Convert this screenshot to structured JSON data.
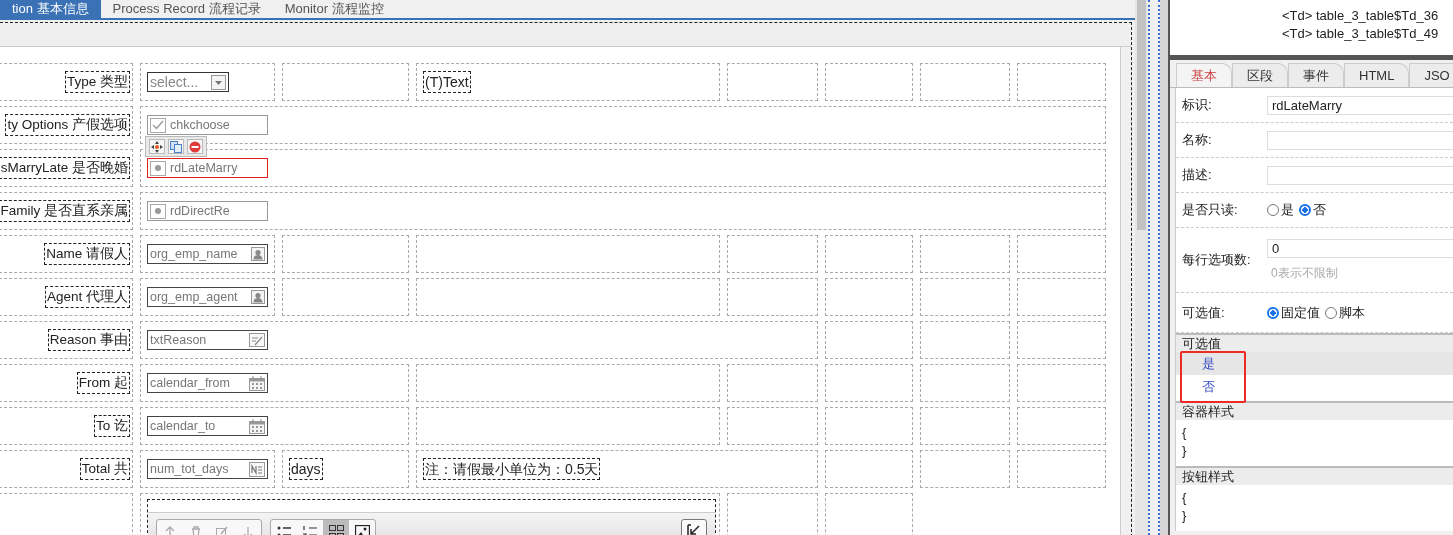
{
  "tabs": [
    {
      "label": "tion 基本信息",
      "selected": true
    },
    {
      "label": "Process Record 流程记录",
      "selected": false
    },
    {
      "label": "Monitor 流程监控",
      "selected": false
    }
  ],
  "form_rows": [
    {
      "label": "Type 类型",
      "cells": [
        {
          "kind": "select",
          "placeholder": "select...",
          "selected": false
        },
        {
          "kind": "empty"
        },
        {
          "kind": "text",
          "text": "(T)Text"
        },
        {
          "kind": "empty"
        },
        {
          "kind": "empty"
        },
        {
          "kind": "empty"
        },
        {
          "kind": "empty"
        }
      ]
    },
    {
      "label": "ty Options 产假选项",
      "cells": [
        {
          "kind": "checkbox",
          "field": "chkchoose",
          "colspan": 7,
          "selected": false,
          "toolbar": true
        }
      ]
    },
    {
      "label": "sMarryLate 是否晚婚",
      "cells": [
        {
          "kind": "radio",
          "field": "rdLateMarry",
          "colspan": 7,
          "selected": true
        }
      ]
    },
    {
      "label": "Family 是否直系亲属",
      "cells": [
        {
          "kind": "radio",
          "field": "rdDirectRe",
          "colspan": 7,
          "selected": false
        }
      ]
    },
    {
      "label": "Name 请假人",
      "cells": [
        {
          "kind": "person",
          "field": "org_emp_name",
          "selected": false
        },
        {
          "kind": "empty"
        },
        {
          "kind": "empty"
        },
        {
          "kind": "empty"
        },
        {
          "kind": "empty"
        },
        {
          "kind": "empty"
        },
        {
          "kind": "empty"
        }
      ]
    },
    {
      "label": "Agent 代理人",
      "cells": [
        {
          "kind": "person",
          "field": "org_emp_agent",
          "selected": false
        },
        {
          "kind": "empty"
        },
        {
          "kind": "empty"
        },
        {
          "kind": "empty"
        },
        {
          "kind": "empty"
        },
        {
          "kind": "empty"
        },
        {
          "kind": "empty"
        }
      ]
    },
    {
      "label": "Reason 事由",
      "cells": [
        {
          "kind": "textarea",
          "field": "txtReason",
          "colspan": 4,
          "selected": false
        },
        {
          "kind": "empty"
        },
        {
          "kind": "empty"
        },
        {
          "kind": "empty"
        }
      ]
    },
    {
      "label": "From 起",
      "cells": [
        {
          "kind": "date",
          "field": "calendar_from",
          "colspan": 2,
          "selected": false
        },
        {
          "kind": "empty"
        },
        {
          "kind": "empty"
        },
        {
          "kind": "empty"
        },
        {
          "kind": "empty"
        },
        {
          "kind": "empty"
        }
      ]
    },
    {
      "label": "To 讫",
      "cells": [
        {
          "kind": "date",
          "field": "calendar_to",
          "colspan": 2,
          "selected": false
        },
        {
          "kind": "empty"
        },
        {
          "kind": "empty"
        },
        {
          "kind": "empty"
        },
        {
          "kind": "empty"
        },
        {
          "kind": "empty"
        }
      ]
    },
    {
      "label": "Total 共",
      "cells": [
        {
          "kind": "number",
          "field": "num_tot_days",
          "selected": false
        },
        {
          "kind": "text",
          "text": "days"
        },
        {
          "kind": "text",
          "text": "注：请假最小单位为：0.5天",
          "colspan": 2
        },
        {
          "kind": "empty"
        },
        {
          "kind": "empty"
        },
        {
          "kind": "empty"
        }
      ]
    },
    {
      "cells": [
        {
          "kind": "editor",
          "colspan": 3,
          "view_buttons": [
            {
              "selected": false
            },
            {
              "selected": false
            },
            {
              "selected": true
            },
            {
              "selected": false
            }
          ]
        },
        {
          "kind": "empty"
        },
        {
          "kind": "empty"
        }
      ]
    }
  ],
  "outline": {
    "lines": [
      "<Td> table_3_table$Td_36",
      "<Td> table_3_table$Td_49"
    ]
  },
  "property_tabs": [
    {
      "label": "基本",
      "selected": true
    },
    {
      "label": "区段",
      "selected": false
    },
    {
      "label": "事件",
      "selected": false
    },
    {
      "label": "HTML",
      "selected": false
    },
    {
      "label": "JSO",
      "selected": false
    }
  ],
  "properties": [
    {
      "kind": "input",
      "label": "标识:",
      "value": "rdLateMarry"
    },
    {
      "kind": "input",
      "label": "名称:"
    },
    {
      "kind": "input",
      "label": "描述:"
    },
    {
      "kind": "radios",
      "label": "是否只读:",
      "options": [
        {
          "label": "是",
          "selected": false
        },
        {
          "label": "否",
          "selected": true
        }
      ]
    },
    {
      "kind": "input",
      "label": "每行选项数:",
      "value": "0",
      "hint": "0表示不限制"
    },
    {
      "kind": "radios",
      "label": "可选值:",
      "options": [
        {
          "label": "固定值",
          "selected": true
        },
        {
          "label": "脚本",
          "selected": false
        }
      ]
    }
  ],
  "sections": [
    {
      "kind": "list",
      "title": "可选值",
      "highlighted": true,
      "items": [
        {
          "label": "是",
          "selected": true
        },
        {
          "label": "否",
          "selected": false
        }
      ]
    },
    {
      "kind": "code",
      "title": "容器样式",
      "lines": [
        "{",
        "}"
      ]
    },
    {
      "kind": "code",
      "title": "按钮样式",
      "lines": [
        "{",
        "}"
      ]
    }
  ]
}
